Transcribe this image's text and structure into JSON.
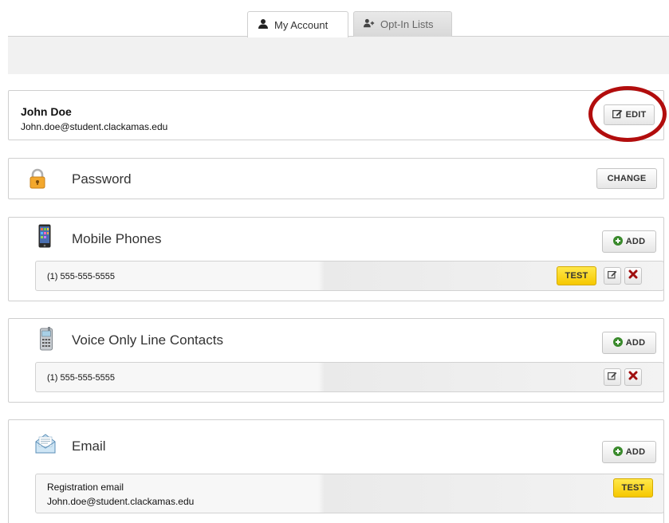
{
  "tabs": [
    {
      "label": "My Account",
      "icon": "user-icon",
      "active": true
    },
    {
      "label": "Opt-In Lists",
      "icon": "user-add-icon",
      "active": false
    }
  ],
  "profile": {
    "name": "John Doe",
    "email": "John.doe@student.clackamas.edu",
    "edit_label": "EDIT"
  },
  "password": {
    "title": "Password",
    "icon": "padlock-icon",
    "change_label": "CHANGE"
  },
  "mobile": {
    "title": "Mobile Phones",
    "icon": "mobile-phone-icon",
    "add_label": "ADD",
    "entries": [
      {
        "number": "(1) 555-555-5555",
        "test_label": "TEST"
      }
    ]
  },
  "voice": {
    "title": "Voice Only Line Contacts",
    "icon": "desk-phone-icon",
    "add_label": "ADD",
    "entries": [
      {
        "number": "(1) 555-555-5555"
      }
    ]
  },
  "email": {
    "title": "Email",
    "icon": "envelope-icon",
    "add_label": "ADD",
    "entries": [
      {
        "label": "Registration email",
        "address": "John.doe@student.clackamas.edu",
        "test_label": "TEST"
      }
    ]
  },
  "colors": {
    "annotation_circle": "#b20d0d",
    "test_button": "#f6c800",
    "add_icon": "#3a8a2c",
    "delete_icon": "#a01010"
  }
}
